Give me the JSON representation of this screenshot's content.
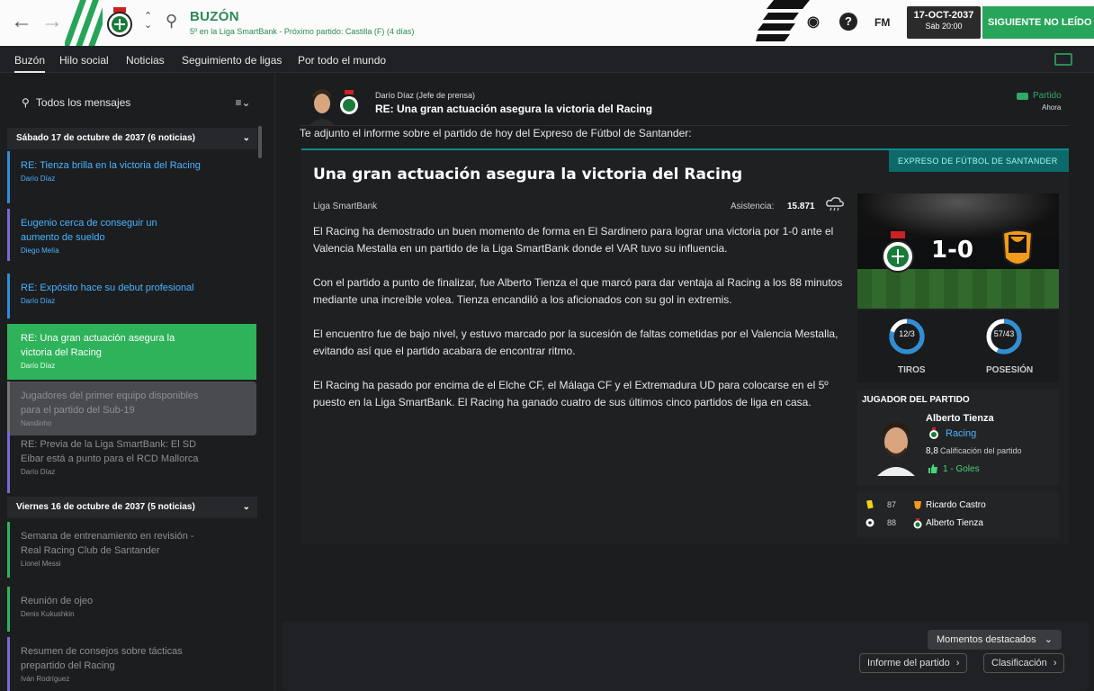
{
  "header": {
    "title": "BUZÓN",
    "subtitle": "5º en la Liga SmartBank - Próximo partido: Castilla (F) (4 días)",
    "fm_label": "FM",
    "date": "17-OCT-2037",
    "day_time": "Sáb 20:00",
    "next_button": "SIGUIENTE NO LEÍDO"
  },
  "tabs": [
    "Buzón",
    "Hilo social",
    "Noticias",
    "Seguimiento de ligas",
    "Por todo el mundo"
  ],
  "sidebar": {
    "filter_label": "Todos los mensajes",
    "groups": [
      {
        "label": "Sábado 17 de octubre de 2037 (6 noticias)"
      },
      {
        "label": "Viernes 16 de octubre de 2037 (5 noticias)"
      }
    ],
    "messages": [
      {
        "title": "RE: Tienza brilla en la victoria del Racing",
        "author": "Darío Díaz",
        "color": "#2e8fd6"
      },
      {
        "title": "Eugenio cerca de conseguir un aumento de sueldo",
        "author": "Diego Melía",
        "color": "#7a6ad0"
      },
      {
        "title": "RE: Expósito hace su debut profesional",
        "author": "Darío Díaz",
        "color": "#2e8fd6"
      },
      {
        "title": "RE: Una gran actuación asegura la victoria del Racing",
        "author": "Darío Díaz",
        "color": "#2eb35a"
      },
      {
        "title": "Jugadores del primer equipo disponibles para el partido del Sub-19",
        "author": "Nandinho",
        "color": "#777777"
      },
      {
        "title": "RE: Previa de la Liga SmartBank: El SD Eibar está a punto para el RCD Mallorca",
        "author": "Darío Díaz",
        "color": "#7a6ad0"
      },
      {
        "title": "Semana de entrenamiento en revisión - Real Racing Club de Santander",
        "author": "Lionel Messi",
        "color": "#2eb35a"
      },
      {
        "title": "Reunión de ojeo",
        "author": "Denis Kukushkin",
        "color": "#2eb35a"
      },
      {
        "title": "Resumen de consejos sobre tácticas prepartido del Racing",
        "author": "Iván Rodríguez",
        "color": "#7a6ad0"
      }
    ]
  },
  "message": {
    "sender": "Darío Díaz  (Jefe de prensa)",
    "subject": "RE: Una gran actuación asegura la victoria del Racing",
    "tag": "Partido",
    "time": "Ahora",
    "intro": "Te adjunto el informe sobre el partido de hoy del Expreso de Fútbol de Santander:"
  },
  "article": {
    "source": "EXPRESO DE FÚTBOL DE SANTANDER",
    "headline": "Una gran actuación asegura la victoria del Racing",
    "league": "Liga SmartBank",
    "attendance_label": "Asistencia:",
    "attendance_value": "15.871",
    "paragraphs": [
      "El Racing ha demostrado un buen momento de forma en El Sardinero para lograr una victoria por 1-0 ante el Valencia Mestalla en un partido de la Liga SmartBank donde el VAR tuvo su influencia.",
      "Con el partido a punto de finalizar, fue Alberto Tienza el que marcó para dar ventaja al Racing a los 88 minutos mediante una increíble volea. Tienza encandiló a los aficionados con su gol in extremis.",
      "El encuentro fue de bajo nivel, y estuvo marcado por la sucesión de faltas cometidas por el Valencia Mestalla, evitando así que el partido acabara de encontrar ritmo.",
      "El Racing ha pasado por encima de el Elche CF, el Málaga CF y el Extremadura UD para colocarse en el 5º puesto en la Liga SmartBank. El Racing ha ganado cuatro de sus últimos cinco partidos de liga en casa."
    ]
  },
  "match": {
    "score": "1-0",
    "shots": {
      "label": "TIROS",
      "value": "12/3",
      "home_share": 0.8
    },
    "possession": {
      "label": "POSESIÓN",
      "value": "57/43",
      "home_share": 0.57
    },
    "potm_title": "JUGADOR DEL PARTIDO",
    "potm_name": "Alberto Tienza",
    "potm_club": "Racing",
    "potm_rating": "8,8",
    "potm_rating_label": "Calificación del partido",
    "potm_goals": "1 - Goles",
    "events": [
      {
        "minute": "87",
        "player": "Ricardo Castro",
        "icon": "yellow-card-icon"
      },
      {
        "minute": "88",
        "player": "Alberto Tienza",
        "icon": "ball-icon"
      }
    ]
  },
  "footer": {
    "highlights": "Momentos destacados",
    "report": "Informe del partido",
    "table": "Clasificación"
  },
  "colors": {
    "accent": "#27a55a",
    "teal": "#0e6a6a",
    "link_blue": "#4ab3ff"
  }
}
